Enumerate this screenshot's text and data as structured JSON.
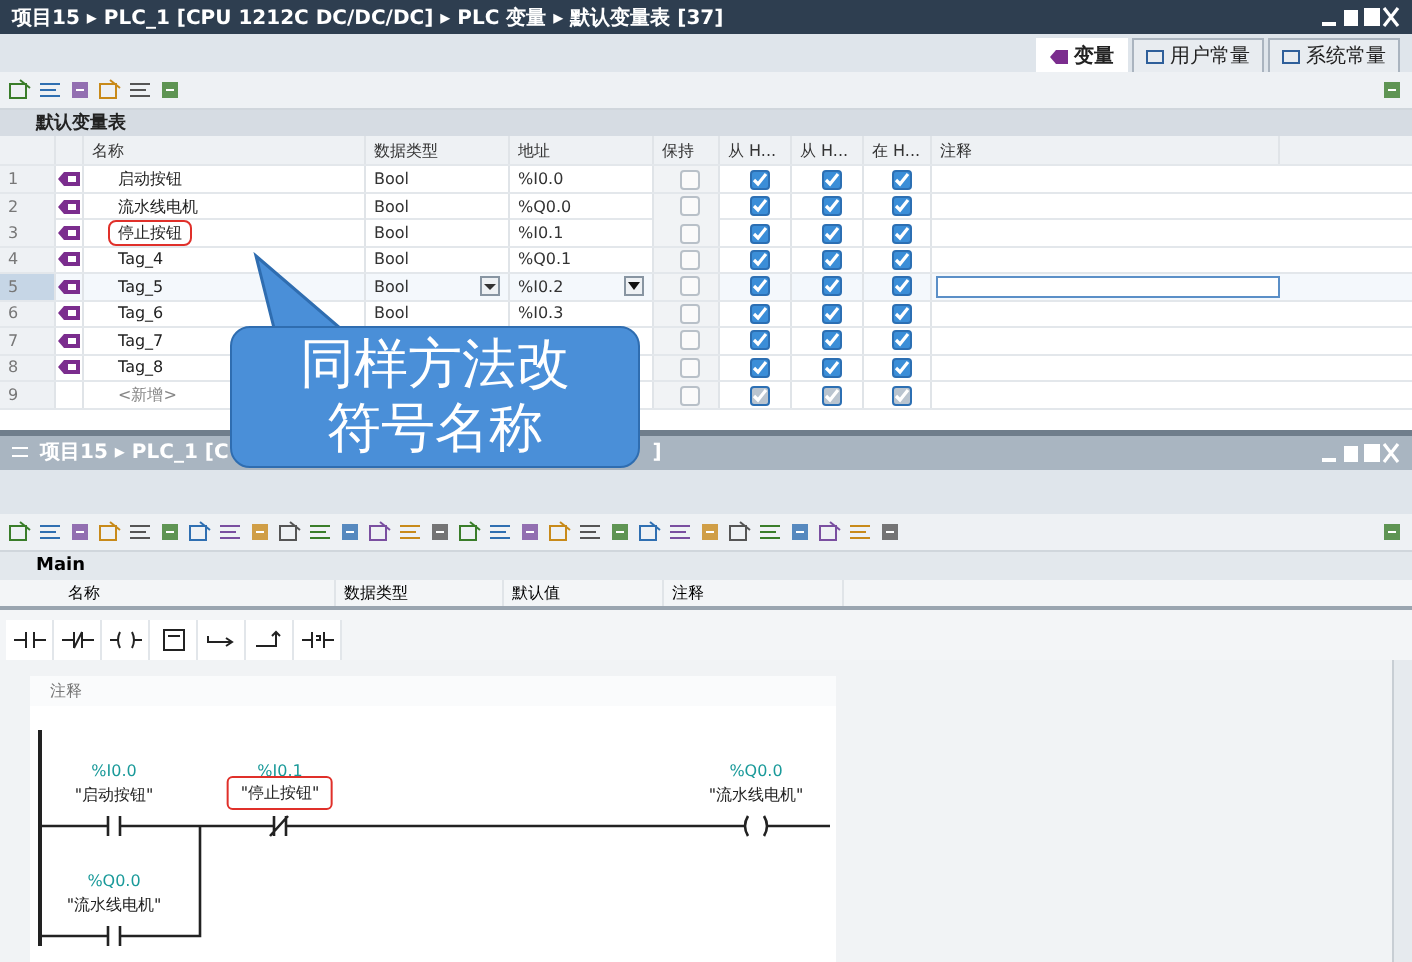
{
  "top_window": {
    "title": "项目15 ▸ PLC_1 [CPU 1212C DC/DC/DC] ▸ PLC 变量 ▸ 默认变量表 [37]",
    "tabs": [
      {
        "label": "变量",
        "selected": true
      },
      {
        "label": "用户常量",
        "selected": false
      },
      {
        "label": "系统常量",
        "selected": false
      }
    ],
    "table": {
      "title": "默认变量表",
      "columns": [
        "名称",
        "数据类型",
        "地址",
        "保持",
        "从 H...",
        "从 H...",
        "在 H...",
        "注释"
      ],
      "rows": [
        {
          "number": "1",
          "name": "启动按钮",
          "type": "Bool",
          "address": "%I0.0",
          "retain": false,
          "hmi_1": true,
          "hmi_2": true,
          "hmi_3": true,
          "selected": false,
          "highlighted": false
        },
        {
          "number": "2",
          "name": "流水线电机",
          "type": "Bool",
          "address": "%Q0.0",
          "retain": false,
          "hmi_1": true,
          "hmi_2": true,
          "hmi_3": true,
          "selected": false,
          "highlighted": false
        },
        {
          "number": "3",
          "name": "停止按钮",
          "type": "Bool",
          "address": "%I0.1",
          "retain": false,
          "hmi_1": true,
          "hmi_2": true,
          "hmi_3": true,
          "selected": false,
          "highlighted": true
        },
        {
          "number": "4",
          "name": "Tag_4",
          "type": "Bool",
          "address": "%Q0.1",
          "retain": false,
          "hmi_1": true,
          "hmi_2": true,
          "hmi_3": true,
          "selected": false,
          "highlighted": false
        },
        {
          "number": "5",
          "name": "Tag_5",
          "type": "Bool",
          "address": "%I0.2",
          "retain": false,
          "hmi_1": true,
          "hmi_2": true,
          "hmi_3": true,
          "selected": true,
          "highlighted": false
        },
        {
          "number": "6",
          "name": "Tag_6",
          "type": "Bool",
          "address": "%I0.3",
          "retain": false,
          "hmi_1": true,
          "hmi_2": true,
          "hmi_3": true,
          "selected": false,
          "highlighted": false
        },
        {
          "number": "7",
          "name": "Tag_7",
          "retain": false,
          "hmi_1": true,
          "hmi_2": true,
          "hmi_3": true,
          "selected": false,
          "highlighted": false
        },
        {
          "number": "8",
          "name": "Tag_8",
          "retain": false,
          "hmi_1": true,
          "hmi_2": true,
          "hmi_3": true,
          "selected": false,
          "highlighted": false
        },
        {
          "number": "9",
          "name": "<新增>",
          "kind": "new",
          "retain": false,
          "hmi_1": true,
          "hmi_2": true,
          "hmi_3": true,
          "selected": false,
          "highlighted": false
        }
      ]
    }
  },
  "bottom_window": {
    "title": "项目15 ▸ PLC_1 [C",
    "title_end": "]",
    "block_name": "Main",
    "columns": [
      "名称",
      "数据类型",
      "默认值",
      "注释"
    ],
    "network": {
      "comment": "注释",
      "rung": [
        {
          "kind": "no",
          "address": "%I0.0",
          "tag": "\"启动按钮\"",
          "highlighted": false
        },
        {
          "kind": "nc",
          "address": "%I0.1",
          "tag": "\"停止按钮\"",
          "highlighted": true
        },
        {
          "kind": "coil",
          "address": "%Q0.0",
          "tag": "\"流水线电机\"",
          "highlighted": false
        }
      ],
      "branch": [
        {
          "kind": "no",
          "address": "%Q0.0",
          "tag": "\"流水线电机\"",
          "highlighted": false
        }
      ]
    }
  },
  "callout": {
    "text": "同样方法改符号名称"
  }
}
